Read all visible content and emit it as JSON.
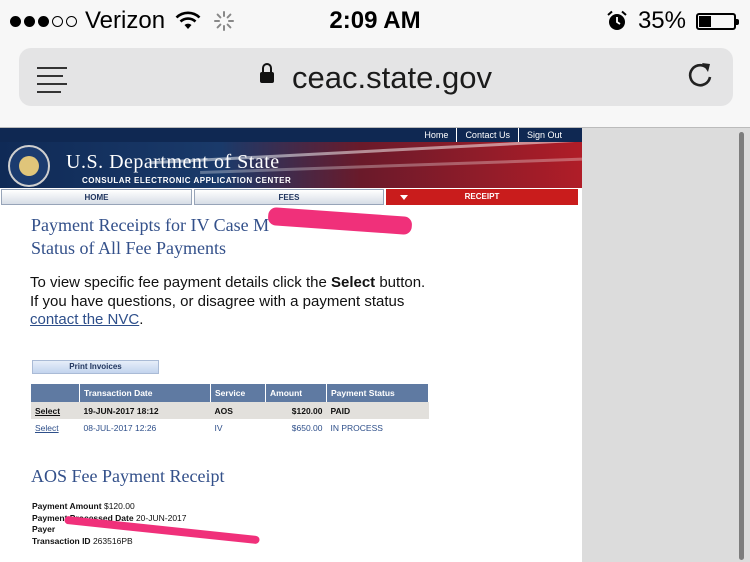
{
  "status_bar": {
    "carrier": "Verizon",
    "time": "2:09 AM",
    "battery": "35%",
    "battery_level": 0.35
  },
  "address_bar": {
    "url": "ceac.state.gov"
  },
  "site": {
    "top_links": [
      "Home",
      "Contact Us",
      "Sign Out"
    ],
    "brand_title": "U.S. Department of State",
    "brand_subtitle": "CONSULAR ELECTRONIC APPLICATION CENTER",
    "tabs": {
      "home": "HOME",
      "fees": "FEES",
      "receipt": "RECEIPT"
    }
  },
  "main": {
    "title_line1": "Payment Receipts for IV Case M",
    "title_line2": "Status of All Fee Payments",
    "info_pre": "To view specific fee payment details click the ",
    "info_bold": "Select",
    "info_mid": " button.",
    "info_line2": "If you have questions, or disagree with a payment status ",
    "info_link": "contact the NVC",
    "info_end": ".",
    "print_button": "Print Invoices",
    "table": {
      "headers": [
        "",
        "Transaction Date",
        "Service",
        "Amount",
        "Payment Status"
      ],
      "rows": [
        {
          "select": "Select",
          "date": "19-JUN-2017 18:12",
          "service": "AOS",
          "amount": "$120.00",
          "status": "PAID"
        },
        {
          "select": "Select",
          "date": "08-JUL-2017 12:26",
          "service": "IV",
          "amount": "$650.00",
          "status": "IN PROCESS"
        }
      ]
    },
    "receipt_title": "AOS Fee Payment Receipt",
    "receipt": {
      "amount_label": "Payment Amount",
      "amount_value": "$120.00",
      "processed_label": "Payment Processed Date",
      "processed_value": "20-JUN-2017",
      "payer_label": "Payer",
      "transaction_label": "Transaction ID",
      "transaction_value": "263516PB"
    }
  },
  "colors": {
    "redaction": "#f0307a",
    "heading_blue": "#33508a",
    "receipt_tab_red": "#c91c1c",
    "table_header": "#5f7aa2"
  }
}
